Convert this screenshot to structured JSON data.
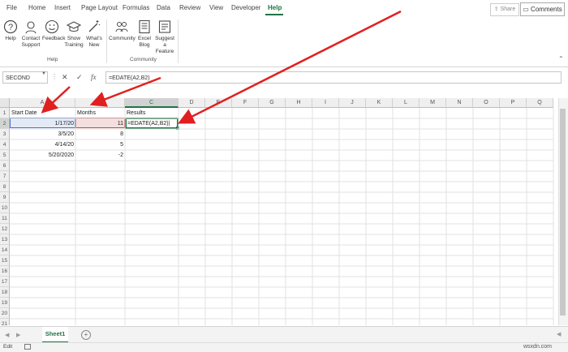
{
  "menu": {
    "tabs": [
      "File",
      "Home",
      "Insert",
      "Page Layout",
      "Formulas",
      "Data",
      "Review",
      "View",
      "Developer",
      "Help"
    ],
    "share": "Share",
    "comments": "Comments"
  },
  "ribbon": {
    "help_group": {
      "label": "Help",
      "buttons": [
        "Help",
        "Contact Support",
        "Feedback",
        "Show Training",
        "What's New"
      ]
    },
    "community_group": {
      "label": "Community",
      "buttons": [
        "Community",
        "Excel Blog",
        "Suggest a Feature"
      ]
    }
  },
  "formula_bar": {
    "name_box": "SECOND",
    "formula": "=EDATE(A2,B2)"
  },
  "grid": {
    "columns": [
      "A",
      "B",
      "C",
      "D",
      "E",
      "F",
      "G",
      "H",
      "I",
      "J",
      "K",
      "L",
      "M",
      "N",
      "O",
      "P",
      "Q"
    ],
    "rows": [
      "1",
      "2",
      "3",
      "4",
      "5",
      "6",
      "7",
      "8",
      "9",
      "10",
      "11",
      "12",
      "13",
      "14",
      "15",
      "16",
      "17",
      "18",
      "19",
      "20",
      "21"
    ],
    "headers": {
      "a": "Start Date",
      "b": "Months",
      "c": "Results"
    },
    "data": [
      {
        "a": "1/17/20",
        "b": "11",
        "c": "=EDATE(A2,B2)"
      },
      {
        "a": "3/5/20",
        "b": "8",
        "c": ""
      },
      {
        "a": "4/14/20",
        "b": "5",
        "c": ""
      },
      {
        "a": "5/20/2020",
        "b": "-2",
        "c": ""
      }
    ]
  },
  "sheet_tabs": {
    "active": "Sheet1"
  },
  "status": {
    "mode": "Edit"
  },
  "watermark": "wsxdn.com",
  "colors": {
    "accent": "#217346",
    "range_a": "#4472c4",
    "range_b": "#c0504d",
    "annotation_arrow": "#e02020"
  }
}
